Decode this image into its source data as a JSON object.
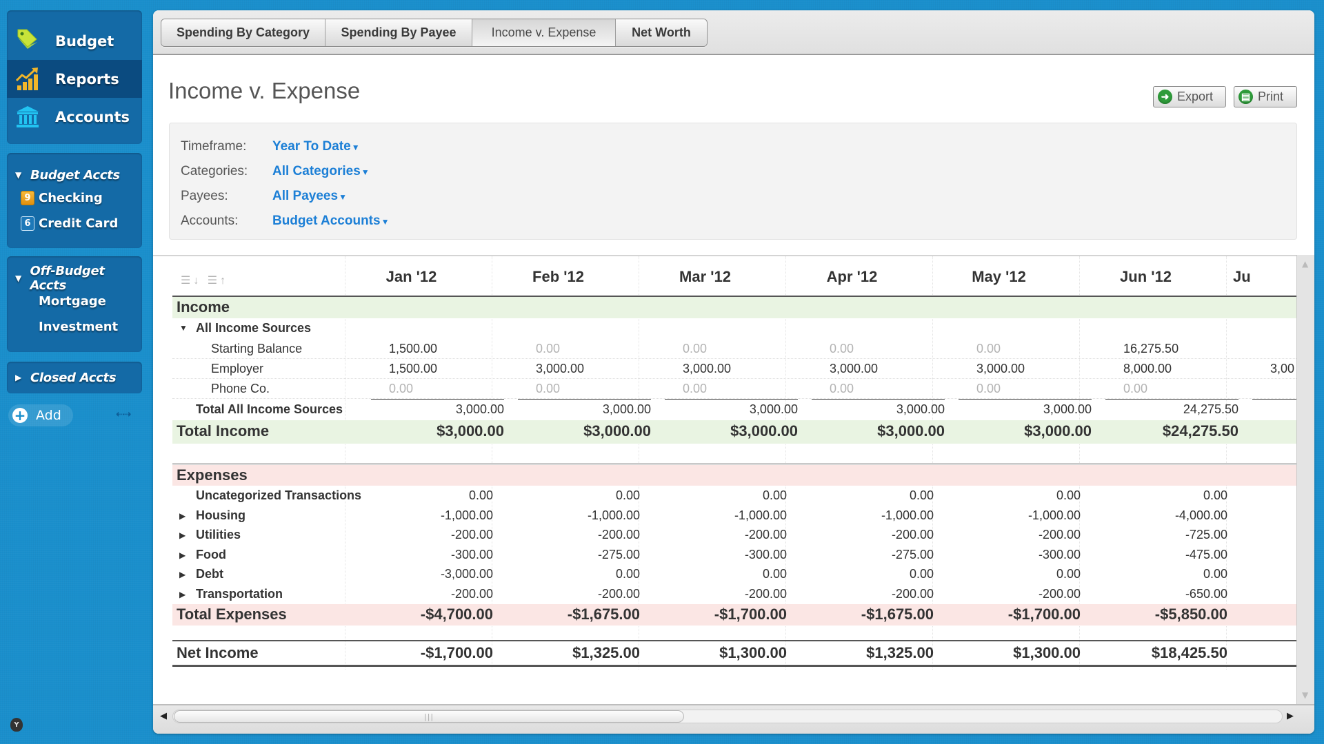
{
  "sidebar": {
    "nav": [
      {
        "label": "Budget",
        "icon": "price-tag-icon",
        "active": false
      },
      {
        "label": "Reports",
        "icon": "chart-icon",
        "active": true
      },
      {
        "label": "Accounts",
        "icon": "bank-icon",
        "active": false
      }
    ],
    "budget_accts": {
      "title": "Budget Accts",
      "expanded": true,
      "items": [
        {
          "label": "Checking",
          "badge": "9",
          "badge_color": "orange"
        },
        {
          "label": "Credit Card",
          "badge": "6",
          "badge_color": "blue"
        }
      ]
    },
    "offbudget_accts": {
      "title": "Off-Budget Accts",
      "expanded": true,
      "items": [
        {
          "label": "Mortgage"
        },
        {
          "label": "Investment"
        }
      ]
    },
    "closed_accts": {
      "title": "Closed Accts",
      "expanded": false
    },
    "add_label": "Add",
    "collapse_glyph": "⇠⇢",
    "logo_letter": "Y"
  },
  "tabs": [
    {
      "label": "Spending By Category",
      "active": false
    },
    {
      "label": "Spending By Payee",
      "active": false
    },
    {
      "label": "Income v. Expense",
      "active": true
    },
    {
      "label": "Net Worth",
      "active": false
    }
  ],
  "page": {
    "title": "Income v. Expense",
    "export_label": "Export",
    "print_label": "Print"
  },
  "filters": [
    {
      "label": "Timeframe:",
      "value": "Year To Date"
    },
    {
      "label": "Categories:",
      "value": "All Categories"
    },
    {
      "label": "Payees:",
      "value": "All Payees"
    },
    {
      "label": "Accounts:",
      "value": "Budget Accounts"
    }
  ],
  "colors": {
    "accent_blue": "#1c7fd6",
    "income_band": "#e9f4e2",
    "expense_band": "#fbe6e4",
    "sidebar_bg": "#146aa6",
    "background": "#1a8fcc"
  },
  "report": {
    "months": [
      "Jan '12",
      "Feb '12",
      "Mar '12",
      "Apr '12",
      "May '12",
      "Jun '12",
      "Ju"
    ],
    "income": {
      "title": "Income",
      "group_label": "All Income Sources",
      "rows": [
        {
          "label": "Starting Balance",
          "values": [
            "1,500.00",
            "0.00",
            "0.00",
            "0.00",
            "0.00",
            "16,275.50",
            ""
          ]
        },
        {
          "label": "Employer",
          "values": [
            "1,500.00",
            "3,000.00",
            "3,000.00",
            "3,000.00",
            "3,000.00",
            "8,000.00",
            "3,00"
          ]
        },
        {
          "label": "Phone Co.",
          "values": [
            "0.00",
            "0.00",
            "0.00",
            "0.00",
            "0.00",
            "0.00",
            ""
          ]
        }
      ],
      "group_total_label": "Total All Income Sources",
      "group_totals": [
        "3,000.00",
        "3,000.00",
        "3,000.00",
        "3,000.00",
        "3,000.00",
        "24,275.50",
        ""
      ],
      "total_label": "Total Income",
      "totals": [
        "$3,000.00",
        "$3,000.00",
        "$3,000.00",
        "$3,000.00",
        "$3,000.00",
        "$24,275.50",
        ""
      ]
    },
    "expenses": {
      "title": "Expenses",
      "rows": [
        {
          "label": "Uncategorized Transactions",
          "expandable": false,
          "values": [
            "0.00",
            "0.00",
            "0.00",
            "0.00",
            "0.00",
            "0.00",
            ""
          ]
        },
        {
          "label": "Housing",
          "expandable": true,
          "values": [
            "-1,000.00",
            "-1,000.00",
            "-1,000.00",
            "-1,000.00",
            "-1,000.00",
            "-4,000.00",
            ""
          ]
        },
        {
          "label": "Utilities",
          "expandable": true,
          "values": [
            "-200.00",
            "-200.00",
            "-200.00",
            "-200.00",
            "-200.00",
            "-725.00",
            ""
          ]
        },
        {
          "label": "Food",
          "expandable": true,
          "values": [
            "-300.00",
            "-275.00",
            "-300.00",
            "-275.00",
            "-300.00",
            "-475.00",
            ""
          ]
        },
        {
          "label": "Debt",
          "expandable": true,
          "values": [
            "-3,000.00",
            "0.00",
            "0.00",
            "0.00",
            "0.00",
            "0.00",
            ""
          ]
        },
        {
          "label": "Transportation",
          "expandable": true,
          "values": [
            "-200.00",
            "-200.00",
            "-200.00",
            "-200.00",
            "-200.00",
            "-650.00",
            ""
          ]
        }
      ],
      "total_label": "Total Expenses",
      "totals": [
        "-$4,700.00",
        "-$1,675.00",
        "-$1,700.00",
        "-$1,675.00",
        "-$1,700.00",
        "-$5,850.00",
        ""
      ]
    },
    "net": {
      "label": "Net Income",
      "values": [
        "-$1,700.00",
        "$1,325.00",
        "$1,300.00",
        "$1,325.00",
        "$1,300.00",
        "$18,425.50",
        ""
      ]
    }
  }
}
